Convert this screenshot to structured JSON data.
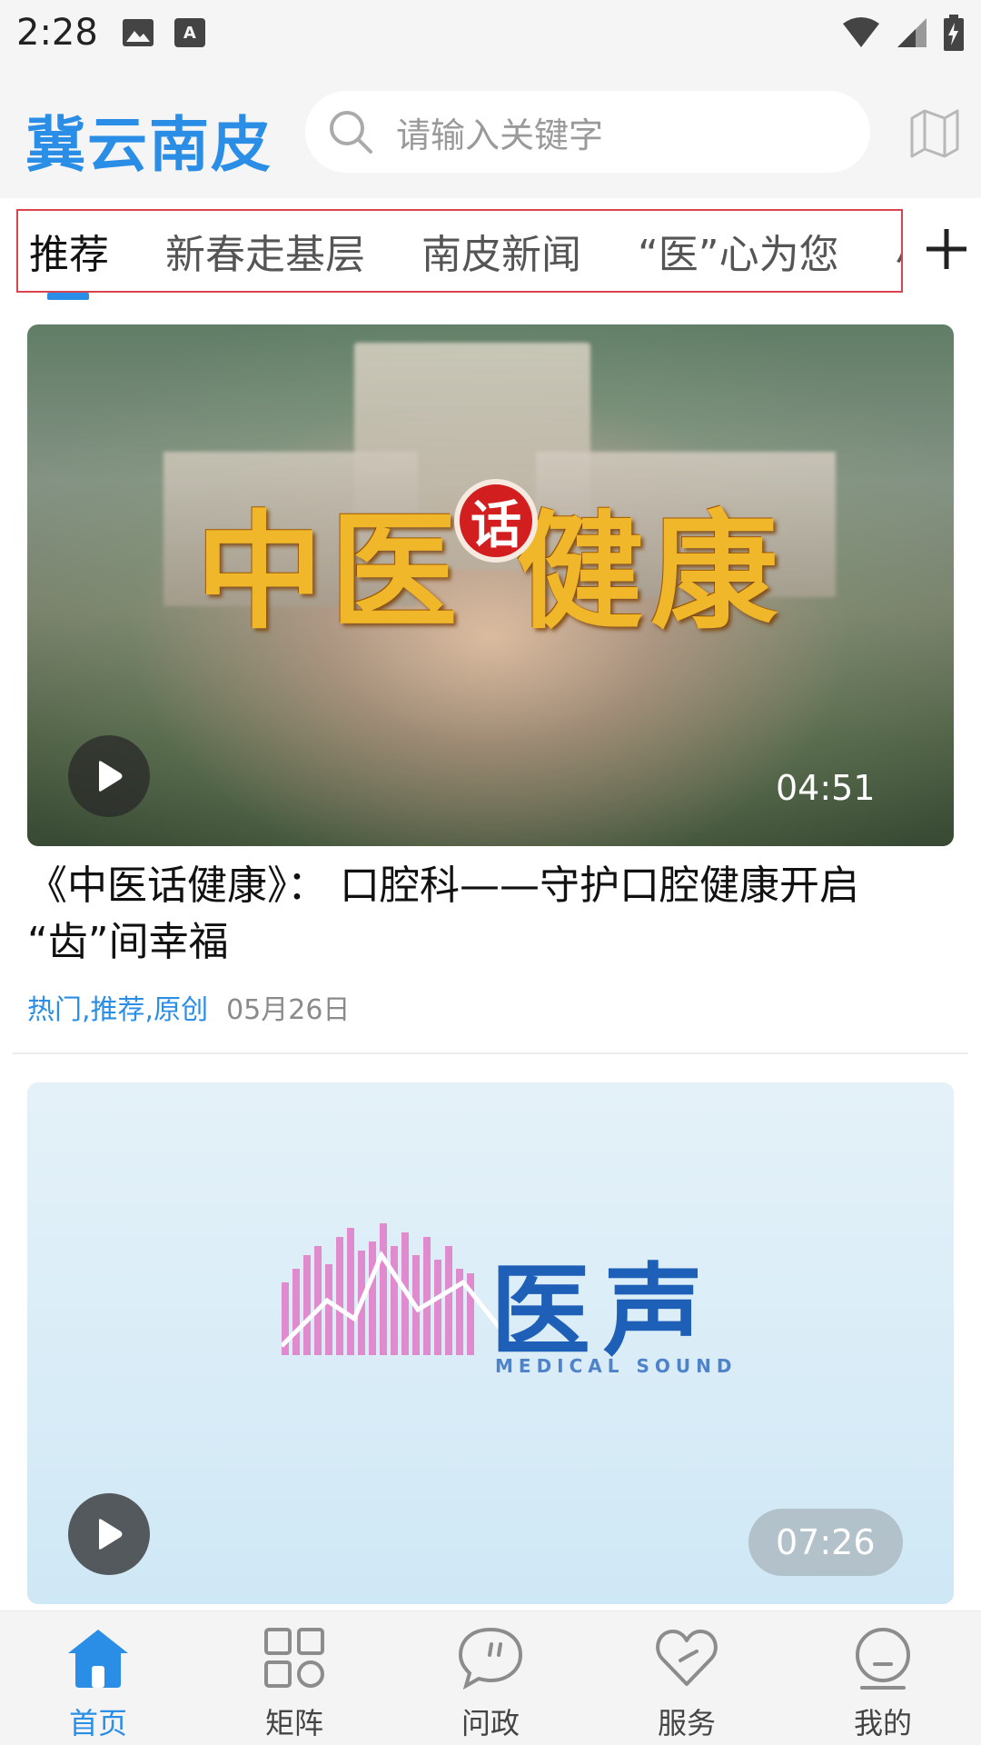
{
  "status_bar": {
    "time": "2:28",
    "icons": [
      "image-icon",
      "font-a-icon",
      "wifi-icon",
      "signal-icon",
      "battery-charging-icon"
    ],
    "font_a_label": "A"
  },
  "header": {
    "brand": "冀云南皮",
    "search_placeholder": "请输入关键字",
    "map_icon": "map-icon"
  },
  "tabs": {
    "items": [
      "推荐",
      "新春走基层",
      "南皮新闻",
      "“医”心为您",
      "小"
    ],
    "active_index": 0,
    "add_icon": "plus-icon"
  },
  "feed": [
    {
      "thumbnail_text": "中医话健康",
      "thumbnail_seal": "话",
      "thumbnail_main": "中医  健康",
      "duration": "04:51",
      "title": "《中医话健康》： 口腔科——守护口腔健康开启 “齿”间幸福",
      "tags": "热门,推荐,原创",
      "date": "05月26日"
    },
    {
      "thumbnail_text": "医声",
      "thumbnail_sub": "MEDICAL SOUND",
      "duration": "07:26"
    }
  ],
  "colors": {
    "accent": "#2b8ee6",
    "tab_frame": "#d9454e"
  },
  "bottom_nav": [
    {
      "label": "首页",
      "icon": "home-icon",
      "active": true
    },
    {
      "label": "矩阵",
      "icon": "grid-icon",
      "active": false
    },
    {
      "label": "问政",
      "icon": "chat-bubble-icon",
      "active": false
    },
    {
      "label": "服务",
      "icon": "heart-icon",
      "active": false
    },
    {
      "label": "我的",
      "icon": "user-face-icon",
      "active": false
    }
  ]
}
